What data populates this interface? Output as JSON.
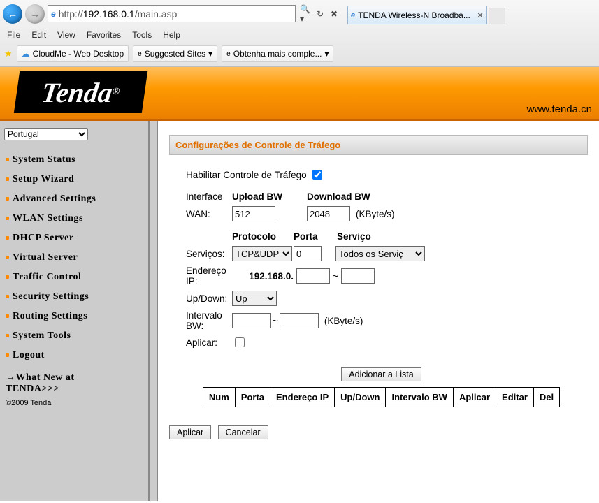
{
  "browser": {
    "url_prefix": "http://",
    "url_host": "192.168.0.1",
    "url_path": "/main.asp",
    "tab_title": "TENDA Wireless-N Broadba...",
    "menu": {
      "file": "File",
      "edit": "Edit",
      "view": "View",
      "favorites": "Favorites",
      "tools": "Tools",
      "help": "Help"
    },
    "favbar": {
      "cloudme": "CloudMe - Web Desktop",
      "suggested": "Suggested Sites",
      "obtenha": "Obtenha mais comple..."
    }
  },
  "header": {
    "logo_text": "Tenda",
    "brand_url": "www.tenda.cn"
  },
  "sidebar": {
    "language": "Portugal",
    "items": [
      {
        "label": "System Status"
      },
      {
        "label": "Setup Wizard"
      },
      {
        "label": "Advanced Settings"
      },
      {
        "label": "WLAN Settings"
      },
      {
        "label": "DHCP Server"
      },
      {
        "label": "Virtual Server"
      },
      {
        "label": "Traffic Control"
      },
      {
        "label": "Security Settings"
      },
      {
        "label": "Routing Settings"
      },
      {
        "label": "System Tools"
      },
      {
        "label": "Logout"
      }
    ],
    "whatnew_line1": "→What New at",
    "whatnew_line2": "TENDA>>>",
    "copyright": "©2009 Tenda"
  },
  "panel": {
    "title": "Configurações de Controle de Tráfego",
    "enable_label": "Habilitar Controle de Tráfego",
    "enable_checked": true,
    "interface_label": "Interface",
    "upload_label": "Upload BW",
    "download_label": "Download BW",
    "wan_label": "WAN:",
    "upload_value": "512",
    "download_value": "2048",
    "bw_unit": "(KByte/s)",
    "services_label": "Serviços:",
    "protocol_header": "Protocolo",
    "port_header": "Porta",
    "service_header": "Serviço",
    "protocol_value": "TCP&UDP",
    "port_value": "0",
    "service_value": "Todos os Serviç",
    "ip_label": "Endereço\nIP:",
    "ip_prefix": "192.168.0.",
    "ip_from": "",
    "ip_to": "",
    "updown_label": "Up/Down:",
    "updown_value": "Up",
    "bwrange_label": "Intervalo\nBW:",
    "bw_from": "",
    "bw_to": "",
    "apply_row_label": "Aplicar:",
    "add_button": "Adicionar a Lista",
    "table_headers": {
      "num": "Num",
      "port": "Porta",
      "ip": "Endereço IP",
      "updown": "Up/Down",
      "bw": "Intervalo BW",
      "apply": "Aplicar",
      "edit": "Editar",
      "del": "Del"
    },
    "apply_btn": "Aplicar",
    "cancel_btn": "Cancelar"
  }
}
